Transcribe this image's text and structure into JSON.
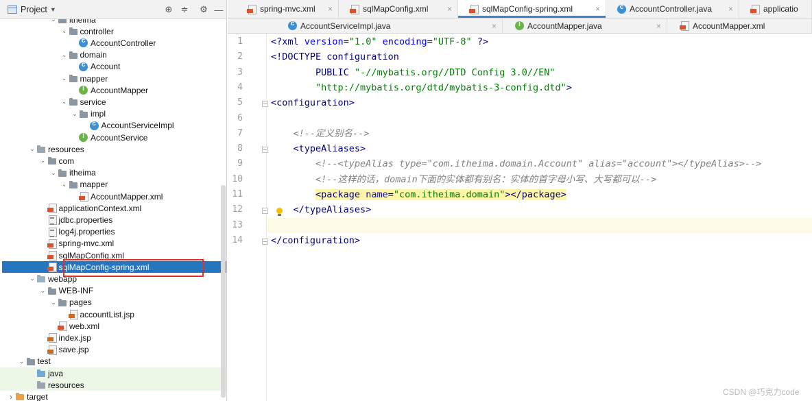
{
  "project_panel": {
    "title": "Project",
    "tree": [
      {
        "label": "itheima",
        "icon": "folder",
        "depth": 5,
        "expanded": true
      },
      {
        "label": "controller",
        "icon": "folder",
        "depth": 6,
        "expanded": true
      },
      {
        "label": "AccountController",
        "icon": "class",
        "depth": 7
      },
      {
        "label": "domain",
        "icon": "folder",
        "depth": 6,
        "expanded": true
      },
      {
        "label": "Account",
        "icon": "class",
        "depth": 7
      },
      {
        "label": "mapper",
        "icon": "folder",
        "depth": 6,
        "expanded": true
      },
      {
        "label": "AccountMapper",
        "icon": "iface",
        "depth": 7
      },
      {
        "label": "service",
        "icon": "folder",
        "depth": 6,
        "expanded": true
      },
      {
        "label": "impl",
        "icon": "folder",
        "depth": 7,
        "expanded": true
      },
      {
        "label": "AccountServiceImpl",
        "icon": "class",
        "depth": 8
      },
      {
        "label": "AccountService",
        "icon": "iface",
        "depth": 7
      },
      {
        "label": "resources",
        "icon": "folder-res",
        "depth": 3,
        "expanded": true
      },
      {
        "label": "com",
        "icon": "folder",
        "depth": 4,
        "expanded": true
      },
      {
        "label": "itheima",
        "icon": "folder",
        "depth": 5,
        "expanded": true
      },
      {
        "label": "mapper",
        "icon": "folder",
        "depth": 6,
        "expanded": true
      },
      {
        "label": "AccountMapper.xml",
        "icon": "xml",
        "depth": 7
      },
      {
        "label": "applicationContext.xml",
        "icon": "xml",
        "depth": 4
      },
      {
        "label": "jdbc.properties",
        "icon": "props",
        "depth": 4
      },
      {
        "label": "log4j.properties",
        "icon": "props",
        "depth": 4
      },
      {
        "label": "spring-mvc.xml",
        "icon": "xml",
        "depth": 4
      },
      {
        "label": "sqlMapConfig.xml",
        "icon": "xml",
        "depth": 4
      },
      {
        "label": "sqlMapConfig-spring.xml",
        "icon": "xml",
        "depth": 4,
        "selected": true
      },
      {
        "label": "webapp",
        "icon": "folder-web",
        "depth": 3,
        "expanded": true
      },
      {
        "label": "WEB-INF",
        "icon": "folder",
        "depth": 4,
        "expanded": true
      },
      {
        "label": "pages",
        "icon": "folder",
        "depth": 5,
        "expanded": true
      },
      {
        "label": "accountList.jsp",
        "icon": "jsp",
        "depth": 6
      },
      {
        "label": "web.xml",
        "icon": "xml",
        "depth": 5
      },
      {
        "label": "index.jsp",
        "icon": "jsp",
        "depth": 4
      },
      {
        "label": "save.jsp",
        "icon": "jsp",
        "depth": 4
      },
      {
        "label": "test",
        "icon": "folder",
        "depth": 2,
        "expanded": true
      },
      {
        "label": "java",
        "icon": "folder-src",
        "depth": 3,
        "green": true
      },
      {
        "label": "resources",
        "icon": "folder-res",
        "depth": 3,
        "green": true
      },
      {
        "label": "target",
        "icon": "folder-orange",
        "depth": 1,
        "expanded": false
      }
    ]
  },
  "tabs_row1": [
    {
      "label": "spring-mvc.xml",
      "icon": "xml"
    },
    {
      "label": "sqlMapConfig.xml",
      "icon": "xml"
    },
    {
      "label": "sqlMapConfig-spring.xml",
      "icon": "xml",
      "active": true
    },
    {
      "label": "AccountController.java",
      "icon": "class"
    },
    {
      "label": "applicatio",
      "icon": "xml"
    }
  ],
  "tabs_row2": [
    {
      "label": "AccountServiceImpl.java",
      "icon": "class"
    },
    {
      "label": "AccountMapper.java",
      "icon": "iface"
    },
    {
      "label": "AccountMapper.xml",
      "icon": "xml"
    }
  ],
  "editor": {
    "line_numbers": [
      "1",
      "2",
      "3",
      "4",
      "5",
      "6",
      "7",
      "8",
      "9",
      "10",
      "11",
      "12",
      "13",
      "14"
    ],
    "lines": [
      "<?xml version=\"1.0\" encoding=\"UTF-8\" ?>",
      "<!DOCTYPE configuration",
      "        PUBLIC \"-//mybatis.org//DTD Config 3.0//EN\"",
      "        \"http://mybatis.org/dtd/mybatis-3-config.dtd\">",
      "<configuration>",
      "",
      "    <!--定义别名-->",
      "    <typeAliases>",
      "        <!--<typeAlias type=\"com.itheima.domain.Account\" alias=\"account\"></typeAlias>-->",
      "        <!--这样的话，domain下面的实体都有别名：实体的首字母小写、大写都可以-->",
      "        <package name=\"com.itheima.domain\"></package>",
      "    </typeAliases>",
      "",
      "</configuration>"
    ]
  },
  "watermark": "CSDN @巧克力code"
}
